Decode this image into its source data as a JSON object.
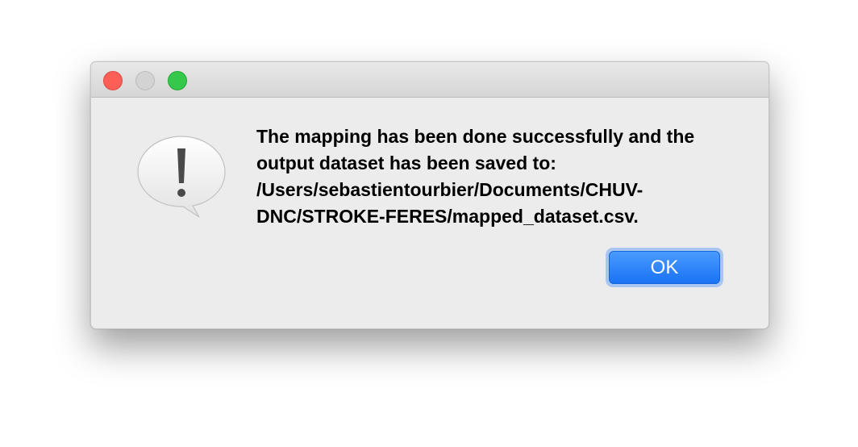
{
  "dialog": {
    "message": "The mapping has been done successfully and the output dataset has been saved to: /Users/sebastientourbier/Documents/CHUV-DNC/STROKE-FERES/mapped_dataset.csv.",
    "ok_label": "OK",
    "icon": "alert-exclamation-icon"
  },
  "titlebar": {
    "buttons": [
      "close",
      "minimize",
      "zoom"
    ]
  },
  "colors": {
    "close": "#fd5f57",
    "minimize_disabled": "#d3d3d3",
    "zoom": "#35c84b",
    "accent": "#1a72f5",
    "window_bg": "#ececec"
  }
}
